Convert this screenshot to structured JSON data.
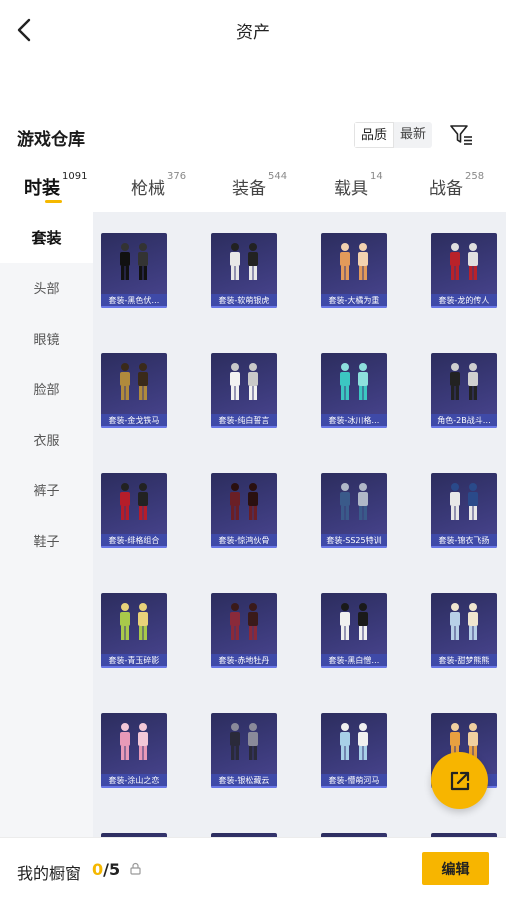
{
  "header": {
    "title": "资产",
    "back_icon": "chevron-left-icon"
  },
  "warehouse": {
    "title": "游戏仓库",
    "sort_options": [
      "品质",
      "最新"
    ],
    "sort_active": "品质",
    "filter_icon": "filter-icon"
  },
  "tabs": [
    {
      "label": "时装",
      "count": "1091",
      "active": true
    },
    {
      "label": "枪械",
      "count": "376",
      "active": false
    },
    {
      "label": "装备",
      "count": "544",
      "active": false
    },
    {
      "label": "载具",
      "count": "14",
      "active": false
    },
    {
      "label": "战备",
      "count": "258",
      "active": false
    }
  ],
  "sidebar": {
    "items": [
      {
        "label": "套装",
        "active": true
      },
      {
        "label": "头部",
        "active": false
      },
      {
        "label": "眼镜",
        "active": false
      },
      {
        "label": "脸部",
        "active": false
      },
      {
        "label": "衣服",
        "active": false
      },
      {
        "label": "裤子",
        "active": false
      },
      {
        "label": "鞋子",
        "active": false
      }
    ]
  },
  "items": [
    {
      "name": "套装-黑色伏…"
    },
    {
      "name": "套装-软萌银虎"
    },
    {
      "name": "套装-大橘为重"
    },
    {
      "name": "套装-龙的传人"
    },
    {
      "name": "套装-金戈铁马"
    },
    {
      "name": "套装-纯白誓言"
    },
    {
      "name": "套装-冰川格…"
    },
    {
      "name": "角色-2B战斗…"
    },
    {
      "name": "套装-绯格组合"
    },
    {
      "name": "套装-惊鸿伙骨"
    },
    {
      "name": "套装-SS25特训"
    },
    {
      "name": "套装-锦衣飞扬"
    },
    {
      "name": "套装-青玉碎影"
    },
    {
      "name": "套装-赤地牡丹"
    },
    {
      "name": "套装-黑白憎…"
    },
    {
      "name": "套装-甜梦熊熊"
    },
    {
      "name": "套装-涂山之恋"
    },
    {
      "name": "套装-银松藏云"
    },
    {
      "name": "套装-懵萌河马"
    },
    {
      "name": ""
    }
  ],
  "fab": {
    "icon": "share-external-icon"
  },
  "footer": {
    "showcase_label": "我的橱窗",
    "showcase_current": "0",
    "showcase_separator": "/",
    "showcase_max": "5",
    "lock_icon": "lock-icon",
    "edit_label": "编辑"
  },
  "colors": {
    "accent": "#f7b500",
    "card_bg": "#2c2d5e",
    "card_label_bg": "#3f4aa8"
  }
}
